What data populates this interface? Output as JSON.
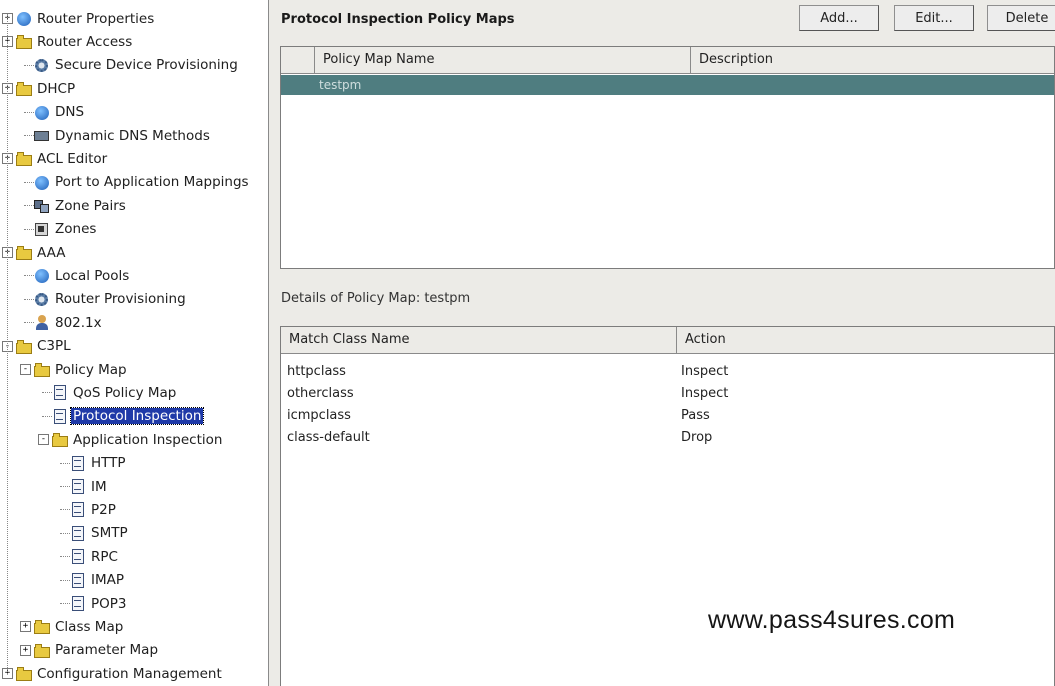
{
  "tree": {
    "items": [
      {
        "label": "Router Properties",
        "icon": "globe-network-icon",
        "expander": "+"
      },
      {
        "label": "Router Access",
        "icon": "folder-user-icon",
        "expander": "+"
      },
      {
        "label": "Secure Device Provisioning",
        "icon": "gear-icon",
        "expander": ""
      },
      {
        "label": "DHCP",
        "icon": "folder-icon",
        "expander": "+"
      },
      {
        "label": "DNS",
        "icon": "globe-icon",
        "expander": ""
      },
      {
        "label": "Dynamic DNS Methods",
        "icon": "network-icon",
        "expander": ""
      },
      {
        "label": "ACL Editor",
        "icon": "folder-icon",
        "expander": "+"
      },
      {
        "label": "Port to Application Mappings",
        "icon": "globe-icon",
        "expander": ""
      },
      {
        "label": "Zone Pairs",
        "icon": "zone-pair-icon",
        "expander": ""
      },
      {
        "label": "Zones",
        "icon": "zone-icon",
        "expander": ""
      },
      {
        "label": "AAA",
        "icon": "folder-icon",
        "expander": "+"
      },
      {
        "label": "Local Pools",
        "icon": "globe-icon",
        "expander": ""
      },
      {
        "label": "Router Provisioning",
        "icon": "gear-icon",
        "expander": ""
      },
      {
        "label": "802.1x",
        "icon": "user-icon",
        "expander": ""
      },
      {
        "label": "C3PL",
        "icon": "folder-icon",
        "expander": "-"
      },
      {
        "label": "Policy Map",
        "icon": "folder-icon",
        "expander": "-"
      },
      {
        "label": "QoS Policy Map",
        "icon": "document-icon",
        "expander": ""
      },
      {
        "label": "Protocol Inspection",
        "icon": "document-icon",
        "expander": "",
        "selected": true
      },
      {
        "label": "Application Inspection",
        "icon": "folder-icon",
        "expander": "-"
      },
      {
        "label": "HTTP",
        "icon": "document-icon",
        "expander": ""
      },
      {
        "label": "IM",
        "icon": "document-icon",
        "expander": ""
      },
      {
        "label": "P2P",
        "icon": "document-icon",
        "expander": ""
      },
      {
        "label": "SMTP",
        "icon": "document-icon",
        "expander": ""
      },
      {
        "label": "RPC",
        "icon": "document-icon",
        "expander": ""
      },
      {
        "label": "IMAP",
        "icon": "document-icon",
        "expander": ""
      },
      {
        "label": "POP3",
        "icon": "document-icon",
        "expander": ""
      },
      {
        "label": "Class Map",
        "icon": "folder-icon",
        "expander": "+"
      },
      {
        "label": "Parameter Map",
        "icon": "folder-icon",
        "expander": "+"
      },
      {
        "label": "Configuration Management",
        "icon": "folder-icon",
        "expander": "+"
      }
    ]
  },
  "policy_maps": {
    "title": "Protocol Inspection Policy Maps",
    "buttons": {
      "add": "Add...",
      "edit": "Edit...",
      "delete": "Delete"
    },
    "columns": [
      "Policy Map Name",
      "Description"
    ],
    "rows": [
      {
        "name": "testpm",
        "description": ""
      }
    ]
  },
  "details": {
    "title": "Details of Policy Map: testpm",
    "columns": [
      "Match Class Name",
      "Action"
    ],
    "rows": [
      {
        "class": "httpclass",
        "action": "Inspect"
      },
      {
        "class": "otherclass",
        "action": "Inspect"
      },
      {
        "class": "icmpclass",
        "action": "Pass"
      },
      {
        "class": "class-default",
        "action": "Drop"
      }
    ]
  },
  "watermark": "www.pass4sures.com",
  "colors": {
    "selection": "#1f3aa8",
    "table_selection": "#4f7d80",
    "panel_bg": "#ecebe7"
  }
}
